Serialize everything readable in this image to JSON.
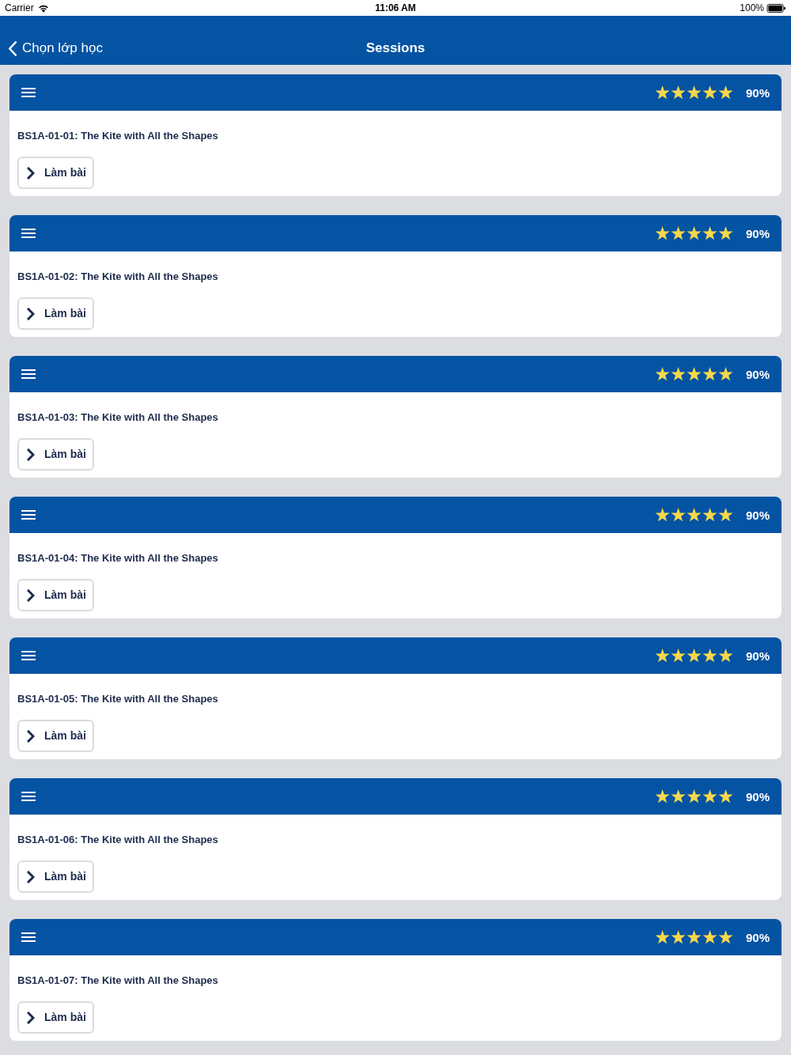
{
  "status_bar": {
    "carrier": "Carrier",
    "time": "11:06 AM",
    "battery": "100%"
  },
  "nav_bar": {
    "back_label": "Chọn lớp học",
    "title": "Sessions"
  },
  "sessions": [
    {
      "stars": 5,
      "score": "90%",
      "title": "BS1A-01-01: The Kite with All the Shapes",
      "button": "Làm bài"
    },
    {
      "stars": 5,
      "score": "90%",
      "title": "BS1A-01-02: The Kite with All the Shapes",
      "button": "Làm bài"
    },
    {
      "stars": 5,
      "score": "90%",
      "title": "BS1A-01-03: The Kite with All the Shapes",
      "button": "Làm bài"
    },
    {
      "stars": 5,
      "score": "90%",
      "title": "BS1A-01-04: The Kite with All the Shapes",
      "button": "Làm bài"
    },
    {
      "stars": 5,
      "score": "90%",
      "title": "BS1A-01-05: The Kite with All the Shapes",
      "button": "Làm bài"
    },
    {
      "stars": 5,
      "score": "90%",
      "title": "BS1A-01-06: The Kite with All the Shapes",
      "button": "Làm bài"
    },
    {
      "stars": 5,
      "score": "90%",
      "title": "BS1A-01-07: The Kite with All the Shapes",
      "button": "Làm bài"
    }
  ]
}
